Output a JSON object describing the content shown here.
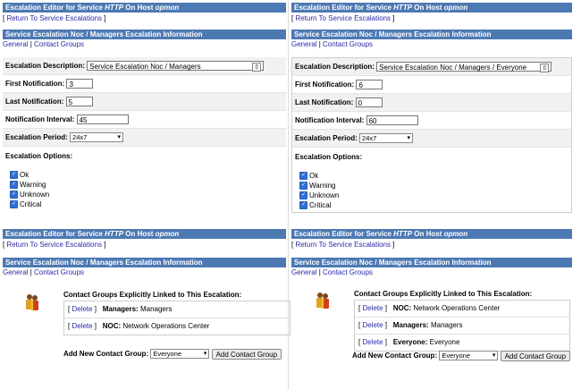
{
  "common": {
    "return_link": "Return To Service Escalations",
    "tab_general": "General",
    "tab_contact_groups": "Contact Groups",
    "tab_sep": "|",
    "lbl_description": "Escalation Description:",
    "lbl_first": "First Notification:",
    "lbl_last": "Last Notification:",
    "lbl_interval": "Notification Interval:",
    "lbl_period": "Escalation Period:",
    "lbl_options": "Escalation Options:",
    "opt_ok": "Ok",
    "opt_warning": "Warning",
    "opt_unknown": "Unknown",
    "opt_critical": "Critical",
    "cg_heading": "Contact Groups Explicitly Linked to This Escalation:",
    "delete": "Delete",
    "add_label": "Add New Contact Group:",
    "add_button": "Add Contact Group",
    "title_prefix": "Escalation Editor for Service ",
    "title_service": "HTTP",
    "title_mid": " On Host ",
    "title_host": "opmon"
  },
  "panels": {
    "tl": {
      "sub_title": "Service Escalation Noc / Managers Escalation Information",
      "description": "Service Escalation Noc / Managers",
      "first": "3",
      "last": "5",
      "interval": "45",
      "period": "24x7"
    },
    "tr": {
      "sub_title": "Service Escalation Noc / Managers Escalation Information",
      "description": "Service Escalation Noc / Managers / Everyone",
      "first": "6",
      "last": "0",
      "interval": "60",
      "period": "24x7"
    },
    "bl": {
      "sub_title": "Service Escalation Noc / Managers Escalation Information",
      "groups": [
        {
          "name": "Managers:",
          "desc": "Managers"
        },
        {
          "name": "NOC:",
          "desc": "Network Operations Center"
        }
      ],
      "add_value": "Everyone"
    },
    "br": {
      "sub_title": "Service Escalation Noc / Managers Escalation Information",
      "groups": [
        {
          "name": "NOC:",
          "desc": "Network Operations Center"
        },
        {
          "name": "Managers:",
          "desc": "Managers"
        },
        {
          "name": "Everyone:",
          "desc": "Everyone"
        }
      ],
      "add_value": "Everyone"
    }
  }
}
